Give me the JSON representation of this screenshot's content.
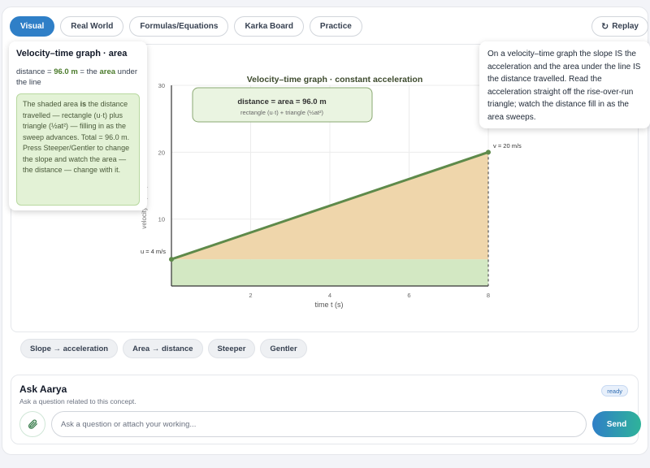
{
  "tabs": [
    {
      "label": "Visual",
      "active": true
    },
    {
      "label": "Real World",
      "active": false
    },
    {
      "label": "Formulas/Equations",
      "active": false
    },
    {
      "label": "Karka Board",
      "active": false
    },
    {
      "label": "Practice",
      "active": false
    }
  ],
  "replay": {
    "icon": "replay-icon",
    "label": "Replay"
  },
  "left_card": {
    "title": "Velocity–time graph · area",
    "dist_prefix": "distance = ",
    "dist_value": "96.0 m",
    "dist_mid": " = the ",
    "dist_area": "area",
    "dist_suffix": " under the line",
    "note_prefix": "The shaded area ",
    "note_is": "is",
    "note_rest": " the distance travelled — rectangle (u·t) plus triangle (½at²) — filling in as the sweep advances. Total = 96.0 m. Press Steeper/Gentler to change the slope and watch the area — the distance — change with it."
  },
  "right_card": {
    "text": "On a velocity–time graph the slope IS the acceleration and the area under the line IS the distance travelled. Read the acceleration straight off the rise-over-run triangle; watch the distance fill in as the area sweeps."
  },
  "chart_data": {
    "type": "area",
    "title": "Velocity–time graph · constant acceleration",
    "xlabel": "time t (s)",
    "ylabel": "velocity v (m/s)",
    "x": [
      0,
      8
    ],
    "y": [
      4,
      20
    ],
    "xlim": [
      0,
      8
    ],
    "ylim": [
      0,
      30
    ],
    "xticks": [
      2,
      4,
      6,
      8
    ],
    "yticks": [
      10,
      20,
      30
    ],
    "start_label": "u = 4 m/s",
    "end_label": "v = 20 m/s",
    "area_box_title_prefix": "distance = area = ",
    "area_box_value": "96.0 m",
    "area_box_subtitle": "rectangle (u·t) + triangle (½at²)",
    "grid": true,
    "colors": {
      "line": "#5e8a4a",
      "triangle": "#efd6ab",
      "rectangle": "#d3e8c3",
      "marker": "#5e8a4a",
      "dash": "#555555"
    }
  },
  "actions": [
    {
      "label": "Slope → acceleration"
    },
    {
      "label": "Area → distance"
    },
    {
      "label": "Steeper"
    },
    {
      "label": "Gentler"
    }
  ],
  "ask": {
    "title": "Ask Aarya",
    "subtitle": "Ask a question related to this concept.",
    "badge": "ready",
    "attach_icon": "paperclip-icon",
    "placeholder": "Ask a question or attach your working...",
    "send": "Send"
  }
}
